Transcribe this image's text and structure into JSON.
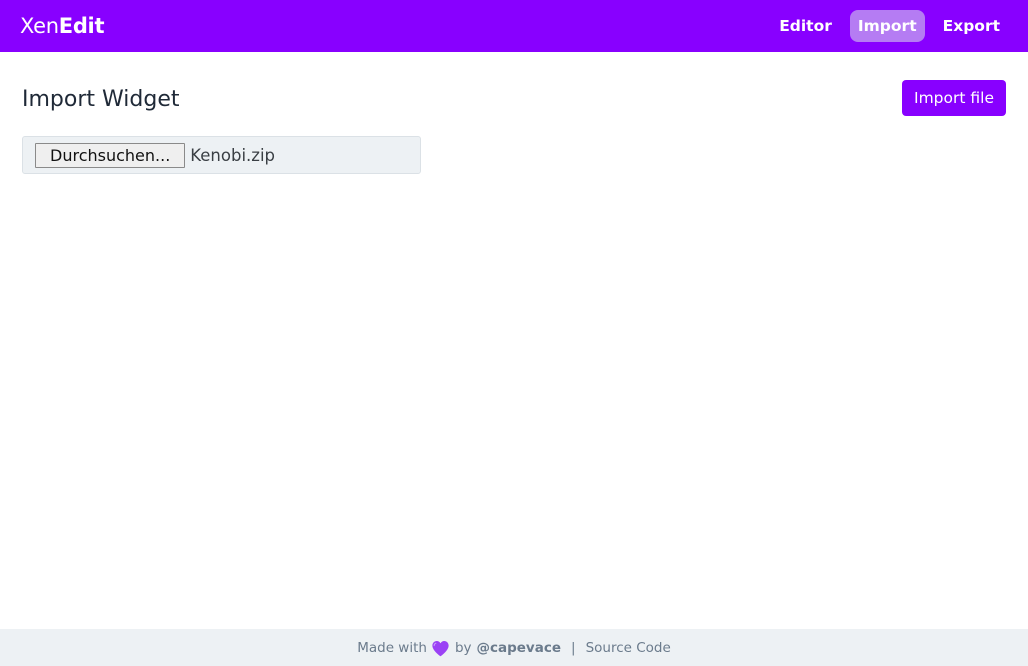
{
  "brand": {
    "light": "Xen",
    "bold": "Edit"
  },
  "nav": {
    "items": [
      {
        "label": "Editor",
        "active": false
      },
      {
        "label": "Import",
        "active": true
      },
      {
        "label": "Export",
        "active": false
      }
    ]
  },
  "page": {
    "title": "Import Widget",
    "import_button": "Import file"
  },
  "file_input": {
    "button_label": "Durchsuchen...",
    "file_name": "Kenobi.zip"
  },
  "footer": {
    "made_with": "Made with",
    "heart_icon": "purple-heart-icon",
    "by": "by",
    "handle": "@capevace",
    "separator": "|",
    "source_link": "Source Code"
  },
  "colors": {
    "brand": "#8800ff",
    "nav_active": "#b57cf3",
    "surface": "#edf1f4",
    "heart": "#9b42f5"
  }
}
